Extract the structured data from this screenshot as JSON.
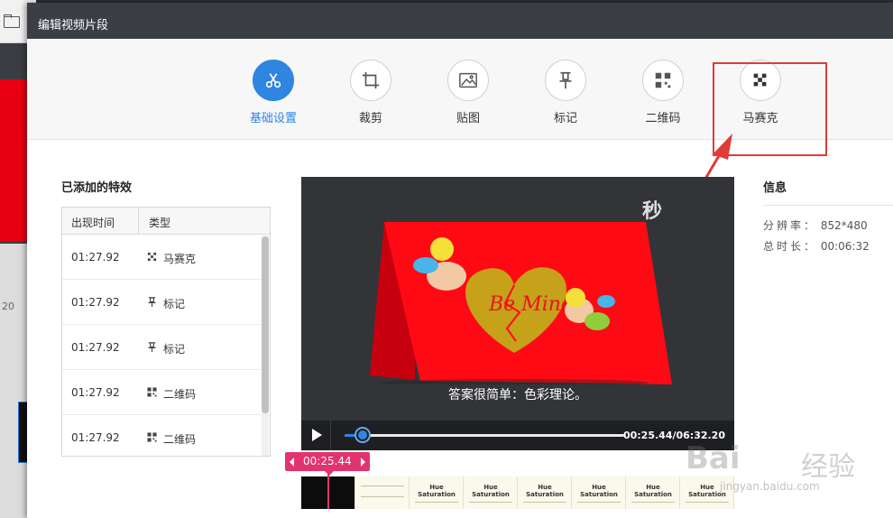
{
  "dialog": {
    "title": "编辑视频片段"
  },
  "background": {
    "ruler_value": "20"
  },
  "toolbar": {
    "items": [
      {
        "label": "基础设置",
        "icon": "scissors-icon",
        "active": true
      },
      {
        "label": "裁剪",
        "icon": "crop-icon",
        "active": false
      },
      {
        "label": "贴图",
        "icon": "image-icon",
        "active": false
      },
      {
        "label": "标记",
        "icon": "pin-icon",
        "active": false
      },
      {
        "label": "二维码",
        "icon": "qrcode-icon",
        "active": false
      },
      {
        "label": "马赛克",
        "icon": "mosaic-icon",
        "active": false
      }
    ],
    "highlight_color": "#e03b3b",
    "accent_color": "#2f86e0"
  },
  "effects": {
    "title": "已添加的特效",
    "headers": [
      "出现时间",
      "类型"
    ],
    "rows": [
      {
        "time": "01:27.92",
        "icon": "mosaic-icon",
        "type": "马赛克"
      },
      {
        "time": "01:27.92",
        "icon": "pin-icon",
        "type": "标记"
      },
      {
        "time": "01:27.92",
        "icon": "pin-icon",
        "type": "标记"
      },
      {
        "time": "01:27.92",
        "icon": "qrcode-icon",
        "type": "二维码"
      },
      {
        "time": "01:27.92",
        "icon": "qrcode-icon",
        "type": "二维码"
      }
    ]
  },
  "video": {
    "card_text": "Be Mine",
    "caption": "答案很简单：色彩理论。",
    "watermark": "秒",
    "time_display": "00:25.44/06:32.20",
    "progress": 0.065
  },
  "info": {
    "title": "信息",
    "resolution_label": "分辨率：",
    "resolution_value": "852*480",
    "duration_label": "总时长：",
    "duration_value": "00:06:32"
  },
  "timeline": {
    "marker_time": "00:25.44",
    "frame_title_1": "Hue",
    "frame_title_2": "Saturation",
    "accent_color": "#e3336e"
  },
  "watermark": {
    "logo": "Bai",
    "logo2": "经验",
    "url": "jingyan.baidu.com"
  }
}
